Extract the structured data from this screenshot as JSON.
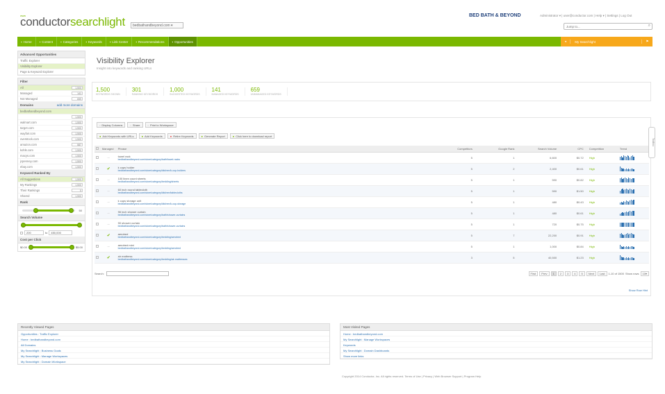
{
  "header": {
    "logo_small": "www",
    "logo_main": "conductor",
    "logo_accent": "searchlight",
    "domain_selector": "bedbathandbeyond.com",
    "client_logo": "BED BATH & BEYOND",
    "user_links": "Administrator ▾ | user@conductor.com | Help ▾ | Settings | Log Out",
    "search_placeholder": "Jump to..."
  },
  "nav": {
    "items": [
      {
        "label": "Home",
        "icon": "home-icon"
      },
      {
        "label": "Content",
        "icon": "content-icon"
      },
      {
        "label": "Categories",
        "icon": "categories-icon"
      },
      {
        "label": "Keywords",
        "icon": "keywords-icon"
      },
      {
        "label": "Link Center",
        "icon": "link-icon"
      },
      {
        "label": "Recommendations",
        "icon": "recommendations-icon"
      },
      {
        "label": "Opportunities",
        "icon": "opportunities-icon",
        "active": true
      }
    ],
    "right_label": "My Searchlight"
  },
  "left": {
    "opportunities": {
      "title": "Advanced Opportunities",
      "items": [
        "Traffic Explorer",
        "Visibility Explorer",
        "Page & Keyword Explorer"
      ]
    },
    "filter": {
      "title": "Filter",
      "rows": [
        {
          "label": "All",
          "count": "1,500"
        },
        {
          "label": "Managed",
          "count": "141"
        },
        {
          "label": "Not Managed",
          "count": "659"
        }
      ]
    },
    "domains": {
      "title": "Domains",
      "link": "add more domains",
      "selected": "bedbathandbeyond.com",
      "selected_count": "1,500",
      "rows": [
        {
          "label": "walmart.com",
          "count": "1,500"
        },
        {
          "label": "target.com",
          "count": "1,500"
        },
        {
          "label": "wayfair.com",
          "count": "1,500"
        },
        {
          "label": "overstock.com",
          "count": "1,500"
        },
        {
          "label": "amazon.com",
          "count": "587"
        },
        {
          "label": "kohls.com",
          "count": "1,500"
        },
        {
          "label": "macys.com",
          "count": "1,500"
        },
        {
          "label": "jcpenney.com",
          "count": "1,500"
        },
        {
          "label": "ebay.com",
          "count": "1,500"
        }
      ]
    },
    "keyword_ranking": {
      "title": "Keyword Ranked By",
      "rows": [
        {
          "label": "All Suggestions",
          "count": "1,500"
        },
        {
          "label": "My Rankings",
          "count": "1,500"
        },
        {
          "label": "Their Rankings",
          "count": "0"
        },
        {
          "label": "Shared",
          "count": "1,500"
        }
      ]
    },
    "rank": {
      "title": "Rank",
      "value": "50"
    },
    "search_volume": {
      "title": "Search Volume",
      "min": "200",
      "sep": "to",
      "max": "450,000"
    },
    "cost_per_click": {
      "title": "Cost per Click",
      "min": "$0.00",
      "max": "$5.00"
    }
  },
  "main": {
    "title": "Visibility Explorer",
    "subtitle": "Insight into keywords and ranking URLs",
    "stats": [
      {
        "value": "1,500",
        "label": "KEYWORDS SHOWN"
      },
      {
        "value": "301",
        "label": "RANKING KEYWORDS"
      },
      {
        "value": "1,000",
        "label": "SUGGESTED KEYWORDS"
      },
      {
        "value": "141",
        "label": "MANAGED KEYWORDS"
      },
      {
        "value": "659",
        "label": "UNMANAGED KEYWORDS"
      }
    ],
    "toolbar1": [
      "Display Columns",
      "Share",
      "Print to Workspace"
    ],
    "toolbar2": [
      "Add Keywords with URLs",
      "Add Keywords",
      "Retire Keywords",
      "Generate Report",
      "Click here to download report"
    ],
    "columns": [
      "Managed",
      "Phrase",
      "Competitors",
      "Google Rank",
      "Search Volume",
      "CPC",
      "Competition",
      "Trend"
    ],
    "rows": [
      {
        "managed": false,
        "phrase": "towel rack",
        "url": "bedbathandbeyond.com/store/category/bath/towel-racks",
        "competitors": "5",
        "rank": "1",
        "volume": "6,600",
        "cpc": "$0.72",
        "competition": "High",
        "trend": [
          5,
          6,
          4,
          7,
          6,
          5,
          7,
          6,
          4,
          6,
          7,
          5
        ]
      },
      {
        "managed": true,
        "phrase": "k cups holder",
        "url": "bedbathandbeyond.com/store/category/kitchen/k-cup-holders",
        "competitors": "5",
        "rank": "2",
        "volume": "2,400",
        "cpc": "$0.61",
        "competition": "High",
        "trend": [
          7,
          5,
          4,
          4,
          3,
          4,
          3,
          4,
          3,
          4,
          4,
          3
        ]
      },
      {
        "managed": false,
        "phrase": "100 linen count sheets",
        "url": "bedbathandbeyond.com/store/category/bedding/sheets",
        "competitors": "5",
        "rank": "1",
        "volume": "590",
        "cpc": "$0.82",
        "competition": "High",
        "trend": [
          6,
          7,
          5,
          6,
          7,
          6,
          5,
          7,
          6,
          5,
          6,
          6
        ]
      },
      {
        "managed": false,
        "phrase": "60 inch round tablecloth",
        "url": "bedbathandbeyond.com/store/category/kitchen/tablecloths",
        "competitors": "5",
        "rank": "1",
        "volume": "590",
        "cpc": "$1.50",
        "competition": "High",
        "trend": [
          4,
          6,
          7,
          5,
          6,
          7,
          6,
          5,
          7,
          6,
          5,
          6
        ]
      },
      {
        "managed": false,
        "phrase": "k cups storage unit",
        "url": "bedbathandbeyond.com/store/category/kitchen/k-cup-storage",
        "competitors": "5",
        "rank": "1",
        "volume": "480",
        "cpc": "$0.43",
        "competition": "High",
        "trend": [
          3,
          4,
          3,
          5,
          4,
          6,
          5,
          4,
          6,
          7,
          6,
          7
        ]
      },
      {
        "managed": false,
        "phrase": "96 inch shower curtain",
        "url": "bedbathandbeyond.com/store/category/bath/shower-curtains",
        "competitors": "5",
        "rank": "1",
        "volume": "480",
        "cpc": "$0.61",
        "competition": "High",
        "trend": [
          3,
          4,
          5,
          4,
          5,
          6,
          5,
          6,
          7,
          6,
          7,
          7
        ]
      },
      {
        "managed": false,
        "phrase": "90 shower curtain",
        "url": "bedbathandbeyond.com/store/category/bath/shower-curtains",
        "competitors": "5",
        "rank": "1",
        "volume": "720",
        "cpc": "$0.75",
        "competition": "High",
        "trend": [
          6,
          6,
          6,
          6,
          6,
          6,
          6,
          6,
          6,
          6,
          6,
          6
        ]
      },
      {
        "managed": true,
        "phrase": "aerobed",
        "url": "bedbathandbeyond.com/store/category/bedding/aerobed",
        "competitors": "5",
        "rank": "7",
        "volume": "22,200",
        "cpc": "$0.91",
        "competition": "High",
        "trend": [
          6,
          7,
          5,
          4,
          5,
          6,
          7,
          5,
          6,
          7,
          6,
          5
        ]
      },
      {
        "managed": false,
        "phrase": "aerobed mini",
        "url": "bedbathandbeyond.com/store/category/bedding/aerobed",
        "competitors": "5",
        "rank": "1",
        "volume": "1,000",
        "cpc": "$0.84",
        "competition": "High",
        "trend": [
          6,
          4,
          3,
          4,
          3,
          4,
          3,
          4,
          3,
          4,
          4,
          3
        ]
      },
      {
        "managed": true,
        "phrase": "air mattress",
        "url": "bedbathandbeyond.com/store/category/bedding/air-mattresses",
        "competitors": "3",
        "rank": "5",
        "volume": "40,500",
        "cpc": "$1.23",
        "competition": "High",
        "trend": [
          7,
          5,
          4,
          4,
          3,
          4,
          3,
          4,
          3,
          4,
          4,
          3
        ]
      }
    ],
    "search_label": "Search:",
    "pager": {
      "first": "First",
      "prev": "Prev",
      "pages": [
        "1",
        "2",
        "3",
        "4",
        "5"
      ],
      "next": "Next",
      "last": "Last",
      "range": "1-10 of 1500",
      "show_label": "Show rows",
      "page_size": "10"
    },
    "side_tab": "Toolbox",
    "print_link": "Show Row Hint"
  },
  "bottom": {
    "recent": {
      "title": "Recently Viewed Pages",
      "items": [
        "Opportunities : Traffic Explorer",
        "Home : bedbathandbeyond.com",
        "All Domains",
        "My Searchlight : Business Goals",
        "My Searchlight : Manage Workspaces",
        "My Searchlight : Domain Workspace"
      ]
    },
    "most": {
      "title": "Most Visited Pages",
      "items": [
        "Home : bedbathandbeyond.com",
        "My Searchlight : Manage Workspaces",
        "Keywords",
        "My Searchlight : Domain Dashboards",
        "Show more links"
      ]
    },
    "copyright": "Copyright 2014 Conductor, Inc. All rights reserved. Terms of Use | Privacy | Web Browser Support | Program Help"
  },
  "colors": {
    "brand_green": "#7ab800",
    "accent_orange": "#f7a81b",
    "link_blue": "#2a6fb0"
  }
}
